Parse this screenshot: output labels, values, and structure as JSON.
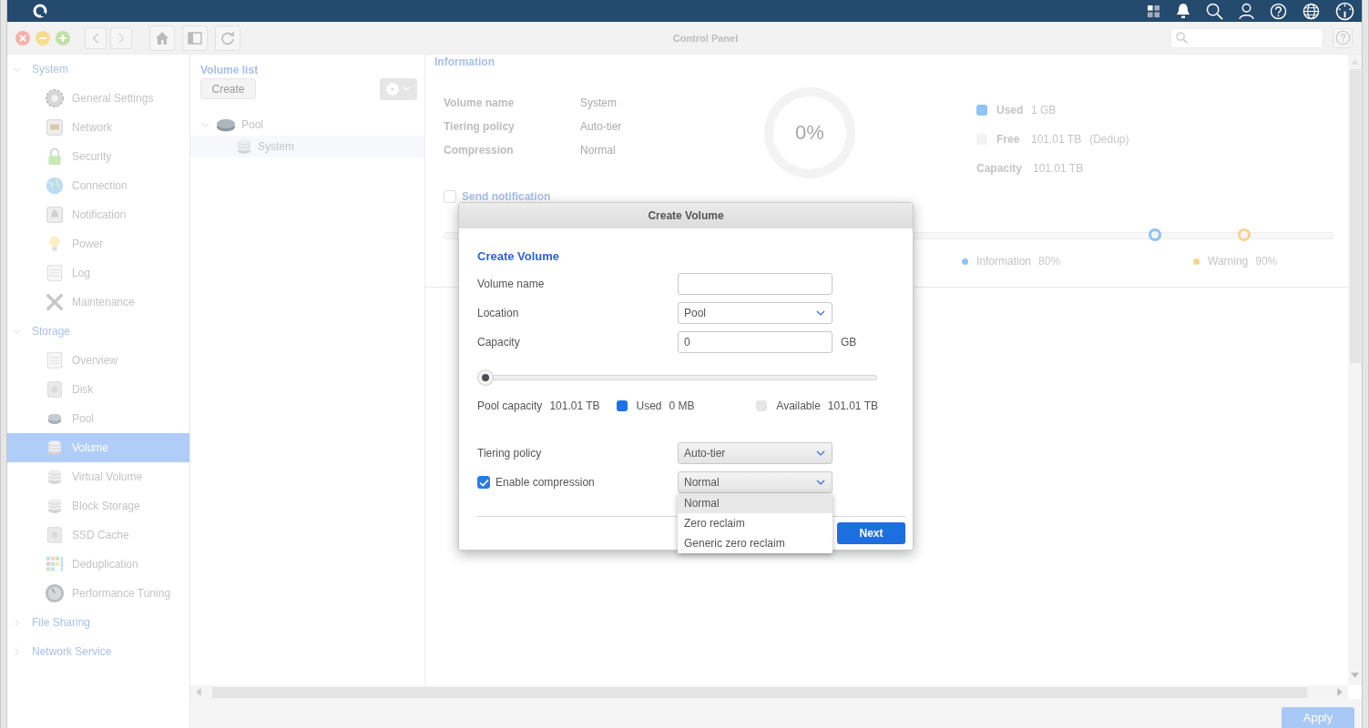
{
  "window": {
    "title": "Control Panel"
  },
  "sidebar": {
    "groups": [
      {
        "label": "System",
        "expanded": true,
        "children": [
          {
            "label": "General Settings",
            "selected": false
          },
          {
            "label": "Network",
            "selected": false
          },
          {
            "label": "Security",
            "selected": false
          },
          {
            "label": "Connection",
            "selected": false
          },
          {
            "label": "Notification",
            "selected": false
          },
          {
            "label": "Power",
            "selected": false
          },
          {
            "label": "Log",
            "selected": false
          },
          {
            "label": "Maintenance",
            "selected": false
          }
        ]
      },
      {
        "label": "Storage",
        "expanded": true,
        "children": [
          {
            "label": "Overview",
            "selected": false
          },
          {
            "label": "Disk",
            "selected": false
          },
          {
            "label": "Pool",
            "selected": false
          },
          {
            "label": "Volume",
            "selected": true
          },
          {
            "label": "Virtual Volume",
            "selected": false
          },
          {
            "label": "Block Storage",
            "selected": false
          },
          {
            "label": "SSD Cache",
            "selected": false
          },
          {
            "label": "Deduplication",
            "selected": false
          },
          {
            "label": "Performance Tuning",
            "selected": false
          }
        ]
      },
      {
        "label": "File Sharing",
        "expanded": false
      },
      {
        "label": "Network Service",
        "expanded": false
      }
    ]
  },
  "volume_list": {
    "title": "Volume list",
    "create_button": "Create",
    "tree": [
      {
        "label": "Pool",
        "expanded": true,
        "children": [
          {
            "label": "System",
            "selected": true
          }
        ]
      }
    ]
  },
  "information": {
    "title": "Information",
    "fields": [
      {
        "label": "Volume name",
        "value": "System"
      },
      {
        "label": "Tiering policy",
        "value": "Auto-tier"
      },
      {
        "label": "Compression",
        "value": "Normal"
      }
    ],
    "usage": "0%",
    "legend": [
      {
        "label": "Used",
        "value": "1 GB",
        "color": "#8fc3f3"
      },
      {
        "label": "Free",
        "value": "101.01 TB",
        "note": "(Dedup)",
        "color": "#f3f3f3"
      },
      {
        "label": "Capacity",
        "value": "101.01 TB"
      }
    ],
    "send_notification": {
      "label": "Send notification",
      "checked": false
    },
    "thresholds": [
      {
        "label": "Information",
        "value": "80%",
        "color": "#8fc3f3",
        "level": 0.8
      },
      {
        "label": "Warning",
        "value": "90%",
        "color": "#f6d58f",
        "level": 0.9
      }
    ]
  },
  "dialog": {
    "title": "Create Volume",
    "heading": "Create Volume",
    "rows": [
      {
        "kind": "text",
        "label": "Volume name"
      },
      {
        "kind": "select",
        "label": "Location",
        "value": "Pool"
      },
      {
        "kind": "text",
        "label": "Capacity",
        "value": "0",
        "unit": "GB"
      },
      {
        "kind": "slider",
        "level": 0
      },
      {
        "kind": "summary",
        "label": "Pool capacity",
        "value": "101.01 TB",
        "items": [
          {
            "label": "Used",
            "value": "0 MB",
            "color": "#1a73e8"
          },
          {
            "label": "Available",
            "value": "101.01 TB",
            "color": "#e6e6e6"
          }
        ]
      },
      {
        "kind": "select",
        "label": "Tiering policy",
        "value": "Auto-tier"
      },
      {
        "kind": "checkselect",
        "label": "Enable compression",
        "checked": true,
        "value": "Normal",
        "expanded": true,
        "options": [
          {
            "label": "Normal",
            "selected": true
          },
          {
            "label": "Zero reclaim",
            "selected": false
          },
          {
            "label": "Generic zero reclaim",
            "selected": false
          }
        ]
      }
    ],
    "next_button": "Next"
  },
  "footer": {
    "apply_button": "Apply"
  }
}
